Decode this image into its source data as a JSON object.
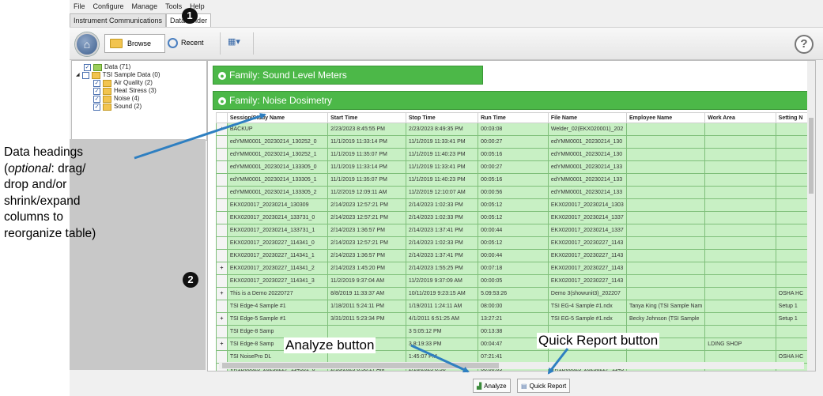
{
  "menu": [
    "File",
    "Configure",
    "Manage",
    "Tools",
    "Help"
  ],
  "tabs": [
    "Instrument Communications",
    "Data Finder"
  ],
  "toolbar": {
    "browse_label": "Browse",
    "recent_label": "Recent",
    "help_icon": "question-mark-icon"
  },
  "tree": [
    {
      "label": "Data (71)",
      "level": 0,
      "checked": true
    },
    {
      "label": "TSI Sample Data (0)",
      "level": 1,
      "checked": false
    },
    {
      "label": "Air Quality (2)",
      "level": 2,
      "checked": true
    },
    {
      "label": "Heat Stress (3)",
      "level": 2,
      "checked": true
    },
    {
      "label": "Noise (4)",
      "level": 2,
      "checked": true
    },
    {
      "label": "Sound (2)",
      "level": 2,
      "checked": true
    }
  ],
  "families": {
    "sound": "Family: Sound Level Meters",
    "noise": "Family: Noise Dosimetry"
  },
  "columns": [
    "Session/Study Name",
    "Start Time",
    "Stop Time",
    "Run Time",
    "File Name",
    "Employee Name",
    "Work Area",
    "Setting N"
  ],
  "rows": [
    {
      "exp": "+",
      "cells": [
        "BACKUP",
        "2/23/2023 8:45:55 PM",
        "2/23/2023 8:49:35 PM",
        "00:03:08",
        "Welder_02(EKX020001)_202",
        "",
        "",
        ""
      ]
    },
    {
      "exp": "",
      "cells": [
        "edYMM0001_20230214_130252_0",
        "11/1/2019 11:33:14 PM",
        "11/1/2019 11:33:41 PM",
        "00:00:27",
        "edYMM0001_20230214_130",
        "",
        "",
        ""
      ]
    },
    {
      "exp": "",
      "cells": [
        "edYMM0001_20230214_130252_1",
        "11/1/2019 11:35:07 PM",
        "11/1/2019 11:40:23 PM",
        "00:05:16",
        "edYMM0001_20230214_130",
        "",
        "",
        ""
      ]
    },
    {
      "exp": "",
      "cells": [
        "edYMM0001_20230214_133305_0",
        "11/1/2019 11:33:14 PM",
        "11/1/2019 11:33:41 PM",
        "00:00:27",
        "edYMM0001_20230214_133",
        "",
        "",
        ""
      ]
    },
    {
      "exp": "",
      "cells": [
        "edYMM0001_20230214_133305_1",
        "11/1/2019 11:35:07 PM",
        "11/1/2019 11:40:23 PM",
        "00:05:16",
        "edYMM0001_20230214_133",
        "",
        "",
        ""
      ]
    },
    {
      "exp": "",
      "cells": [
        "edYMM0001_20230214_133305_2",
        "11/2/2019 12:09:11 AM",
        "11/2/2019 12:10:07 AM",
        "00:00:56",
        "edYMM0001_20230214_133",
        "",
        "",
        ""
      ]
    },
    {
      "exp": "",
      "cells": [
        "EKX020017_20230214_130309",
        "2/14/2023 12:57:21 PM",
        "2/14/2023 1:02:33 PM",
        "00:05:12",
        "EKX020017_20230214_1303",
        "",
        "",
        ""
      ]
    },
    {
      "exp": "",
      "cells": [
        "EKX020017_20230214_133731_0",
        "2/14/2023 12:57:21 PM",
        "2/14/2023 1:02:33 PM",
        "00:05:12",
        "EKX020017_20230214_1337",
        "",
        "",
        ""
      ]
    },
    {
      "exp": "",
      "cells": [
        "EKX020017_20230214_133731_1",
        "2/14/2023 1:36:57 PM",
        "2/14/2023 1:37:41 PM",
        "00:00:44",
        "EKX020017_20230214_1337",
        "",
        "",
        ""
      ]
    },
    {
      "exp": "",
      "cells": [
        "EKX020017_20230227_114341_0",
        "2/14/2023 12:57:21 PM",
        "2/14/2023 1:02:33 PM",
        "00:05:12",
        "EKX020017_20230227_1143",
        "",
        "",
        ""
      ]
    },
    {
      "exp": "",
      "cells": [
        "EKX020017_20230227_114341_1",
        "2/14/2023 1:36:57 PM",
        "2/14/2023 1:37:41 PM",
        "00:00:44",
        "EKX020017_20230227_1143",
        "",
        "",
        ""
      ]
    },
    {
      "exp": "+",
      "cells": [
        "EKX020017_20230227_114341_2",
        "2/14/2023 1:45:20 PM",
        "2/14/2023 1:55:25 PM",
        "00:07:18",
        "EKX020017_20230227_1143",
        "",
        "",
        ""
      ]
    },
    {
      "exp": "",
      "cells": [
        "EKX020017_20230227_114341_3",
        "11/2/2019 9:37:04 AM",
        "11/2/2019 9:37:09 AM",
        "00:00:05",
        "EKX020017_20230227_1143",
        "",
        "",
        ""
      ]
    },
    {
      "exp": "+",
      "cells": [
        "This is a Demo 20220727",
        "8/8/2019 11:33:37 AM",
        "10/11/2019 9:23:15 AM",
        "5.09:53:26",
        "Demo 3(showunit3)_202207",
        "",
        "",
        "OSHA HC"
      ]
    },
    {
      "exp": "",
      "cells": [
        "TSI Edge-4 Sample #1",
        "1/18/2011 5:24:11 PM",
        "1/19/2011 1:24:11 AM",
        "08:00:00",
        "TSI EG-4 Sample #1.ndx",
        "Tanya King (TSI Sample Nam",
        "",
        "Setup 1"
      ]
    },
    {
      "exp": "+",
      "cells": [
        "TSI Edge-5 Sample #1",
        "3/31/2011 5:23:34 PM",
        "4/1/2011 6:51:25 AM",
        "13:27:21",
        "TSI EG-5 Sample #1.ndx",
        "Becky Johnson (TSI Sample",
        "",
        "Setup 1"
      ]
    },
    {
      "exp": "",
      "cells": [
        "TSI Edge-8 Samp",
        "",
        "3 5:05:12 PM",
        "00:13:38",
        "",
        "",
        "",
        ""
      ]
    },
    {
      "exp": "+",
      "cells": [
        "TSI Edge-8 Samp",
        "",
        "3 8:19:33 PM",
        "00:04:47",
        "",
        "",
        "LDING SHOP",
        ""
      ]
    },
    {
      "exp": "",
      "cells": [
        "TSI NoisePro DL",
        "",
        "1:45:07 PM",
        "07:21:41",
        "",
        "",
        "",
        "OSHA HC"
      ]
    },
    {
      "exp": "",
      "cells": [
        "VR1D00023_20230227_114331_0",
        "2/16/2023 8:58:17 AM",
        "2/16/2023 8:58",
        "00:00:09",
        "VR1D00023_20230227_1143",
        "",
        "",
        ""
      ]
    }
  ],
  "bottom": {
    "analyze": "Analyze",
    "quick_report": "Quick Report"
  },
  "annotations": {
    "badge1": "1",
    "badge2": "2",
    "headings_lines": [
      "Data headings",
      "(optional:  drag/",
      "drop and/or",
      "shrink/expand",
      "columns to",
      "reorganize table)"
    ],
    "analyze_callout": "Analyze button",
    "quick_report_callout": "Quick Report button",
    "arrow_color": "#2e7fc1"
  }
}
